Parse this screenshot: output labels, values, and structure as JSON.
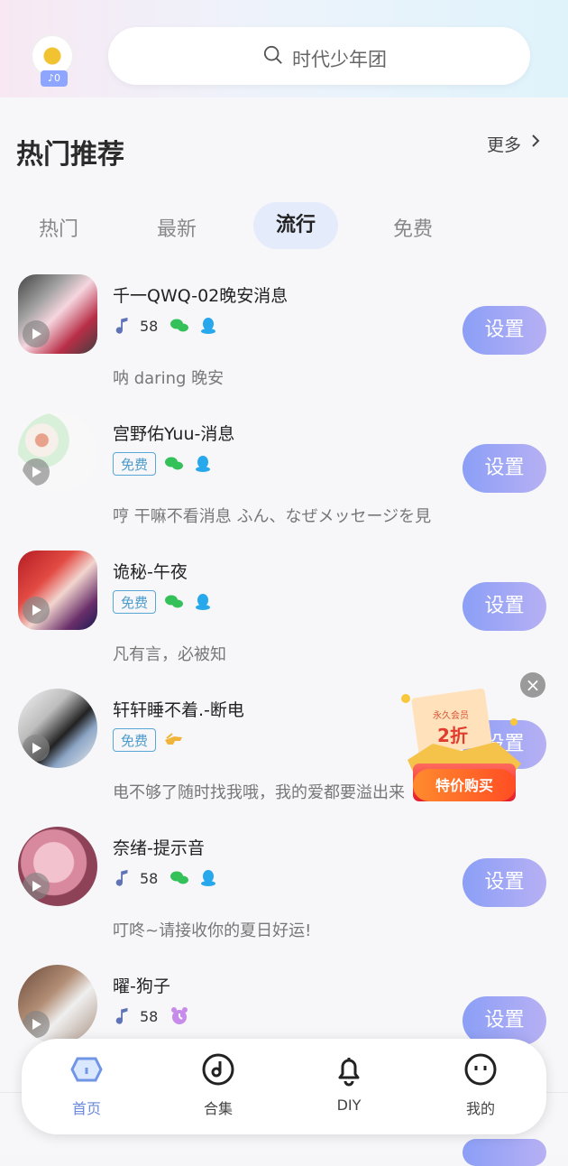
{
  "header": {
    "avatar_badge": "♪0",
    "search_placeholder": "时代少年团"
  },
  "section": {
    "title": "热门推荐",
    "more_label": "更多"
  },
  "tabs": [
    {
      "label": "热门"
    },
    {
      "label": "最新"
    },
    {
      "label": "流行"
    },
    {
      "label": "免费"
    }
  ],
  "list": [
    {
      "name": "千一QWQ-02晚安消息",
      "count": "58",
      "desc": "呐 daring 晚安",
      "button": "设置"
    },
    {
      "name": "宫野佑Yuu-消息",
      "badge": "免费",
      "desc": "哼 干嘛不看消息 ふん、なぜメッセージを見",
      "button": "设置"
    },
    {
      "name": "诡秘-午夜",
      "badge": "免费",
      "desc": "凡有言，必被知",
      "button": "设置"
    },
    {
      "name": "轩轩睡不着.-断电",
      "badge": "免费",
      "desc": "电不够了随时找我哦，我的爱都要溢出来",
      "button": "设置"
    },
    {
      "name": "奈绪-提示音",
      "count": "58",
      "desc": "叮咚~请接收你的夏日好运!",
      "button": "设置"
    },
    {
      "name": "曜-狗子",
      "count": "58",
      "desc": "",
      "button": "设置"
    }
  ],
  "promo": {
    "title": "永久会员",
    "discount": "2折",
    "button": "特价购买",
    "close": "×"
  },
  "nav": [
    {
      "label": "首页"
    },
    {
      "label": "合集"
    },
    {
      "label": "DIY"
    },
    {
      "label": "我的"
    }
  ],
  "colors": {
    "accent": "#6a89da",
    "button_start": "#8b9ff6",
    "button_end": "#b7b0f4",
    "wechat": "#35c15a",
    "qq": "#27a8ec",
    "free_border": "#57a7d4"
  }
}
